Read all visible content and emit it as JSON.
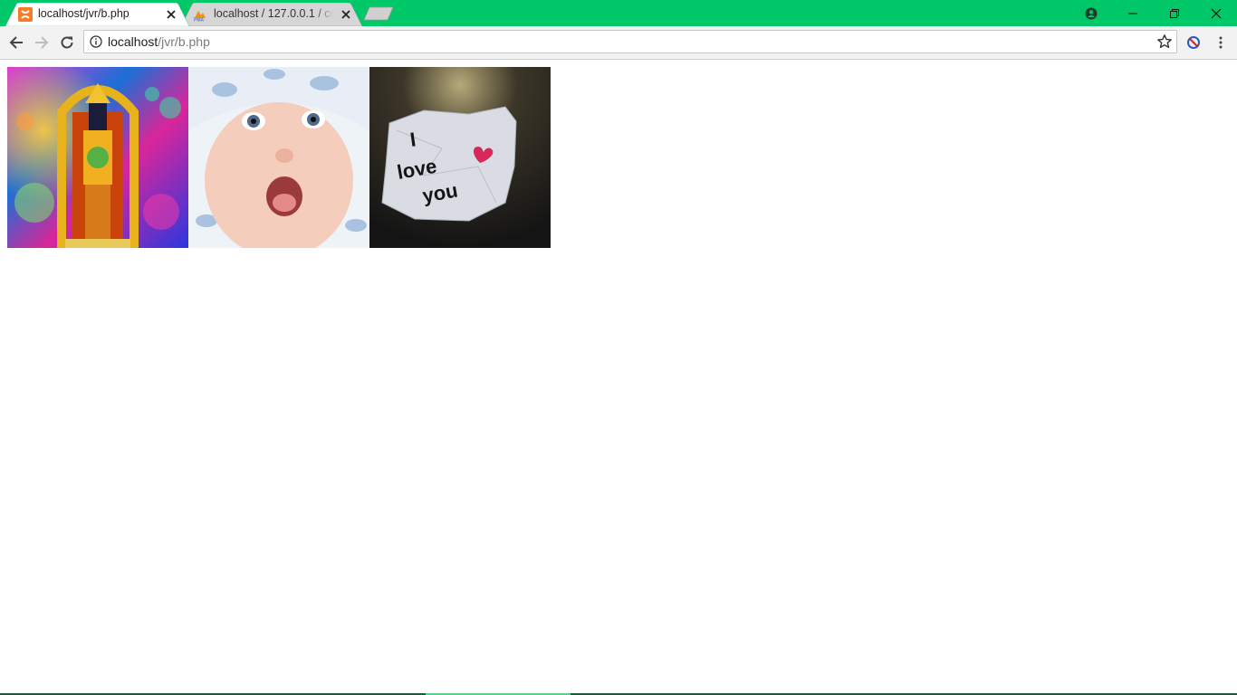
{
  "browser": {
    "tabs": [
      {
        "title": "localhost/jvr/b.php",
        "active": true,
        "favicon": "xampp-icon"
      },
      {
        "title": "localhost / 127.0.0.1 / coc",
        "active": false,
        "favicon": "phpmyadmin-icon"
      }
    ],
    "address": {
      "host": "localhost",
      "path": "/jvr/b.php"
    },
    "theme_color": "#00c767"
  },
  "page": {
    "images": [
      {
        "name": "deity-image",
        "alt": ""
      },
      {
        "name": "baby-image",
        "alt": ""
      },
      {
        "name": "love-note-image",
        "alt": ""
      }
    ],
    "note_text": {
      "line1": "I",
      "line2": "love",
      "line3": "you"
    }
  }
}
